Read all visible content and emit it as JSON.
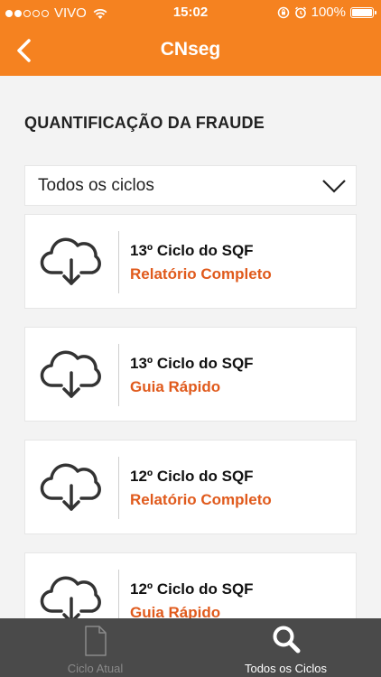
{
  "status_bar": {
    "carrier": "VIVO",
    "time": "15:02",
    "battery": "100%"
  },
  "nav": {
    "title": "CNseg"
  },
  "section": {
    "title": "QUANTIFICAÇÃO DA FRAUDE"
  },
  "filter": {
    "selected": "Todos os ciclos"
  },
  "documents": [
    {
      "title": "13º Ciclo do SQF",
      "link": "Relatório Completo",
      "icon": "cloud-download-icon"
    },
    {
      "title": "13º Ciclo do SQF",
      "link": "Guia Rápido",
      "icon": "cloud-download-icon"
    },
    {
      "title": "12º Ciclo do SQF",
      "link": "Relatório Completo",
      "icon": "cloud-download-icon"
    },
    {
      "title": "12º Ciclo do SQF",
      "link": "Guia Rápido",
      "icon": "cloud-download-icon"
    }
  ],
  "tabs": [
    {
      "label": "Ciclo Atual",
      "icon": "document-icon",
      "active": false
    },
    {
      "label": "Todos os Ciclos",
      "icon": "search-icon",
      "active": true
    }
  ],
  "colors": {
    "brand_orange": "#f58220",
    "link_orange": "#e05a1c",
    "tab_bar": "#4a4a4a",
    "background": "#f3f3f3"
  }
}
